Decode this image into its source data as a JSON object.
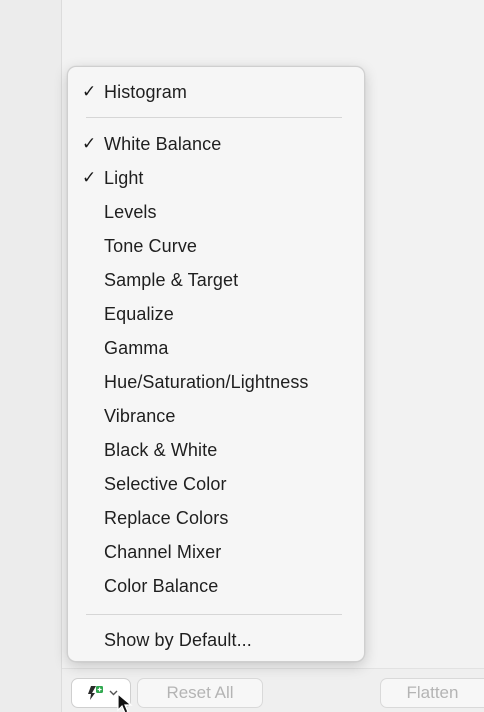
{
  "menu": {
    "items": [
      {
        "label": "Histogram",
        "checked": true
      },
      {
        "label": "White Balance",
        "checked": true
      },
      {
        "label": "Light",
        "checked": true
      },
      {
        "label": "Levels",
        "checked": false
      },
      {
        "label": "Tone Curve",
        "checked": false
      },
      {
        "label": "Sample & Target",
        "checked": false
      },
      {
        "label": "Equalize",
        "checked": false
      },
      {
        "label": "Gamma",
        "checked": false
      },
      {
        "label": "Hue/Saturation/Lightness",
        "checked": false
      },
      {
        "label": "Vibrance",
        "checked": false
      },
      {
        "label": "Black & White",
        "checked": false
      },
      {
        "label": "Selective Color",
        "checked": false
      },
      {
        "label": "Replace Colors",
        "checked": false
      },
      {
        "label": "Channel Mixer",
        "checked": false
      },
      {
        "label": "Color Balance",
        "checked": false
      },
      {
        "label": "Show by Default...",
        "checked": false
      }
    ],
    "check_glyph": "✓"
  },
  "toolbar": {
    "add_icon": "add-adjustment-icon",
    "reset_label": "Reset All",
    "flatten_label": "Flatten",
    "accent_green": "#2fa84f"
  }
}
